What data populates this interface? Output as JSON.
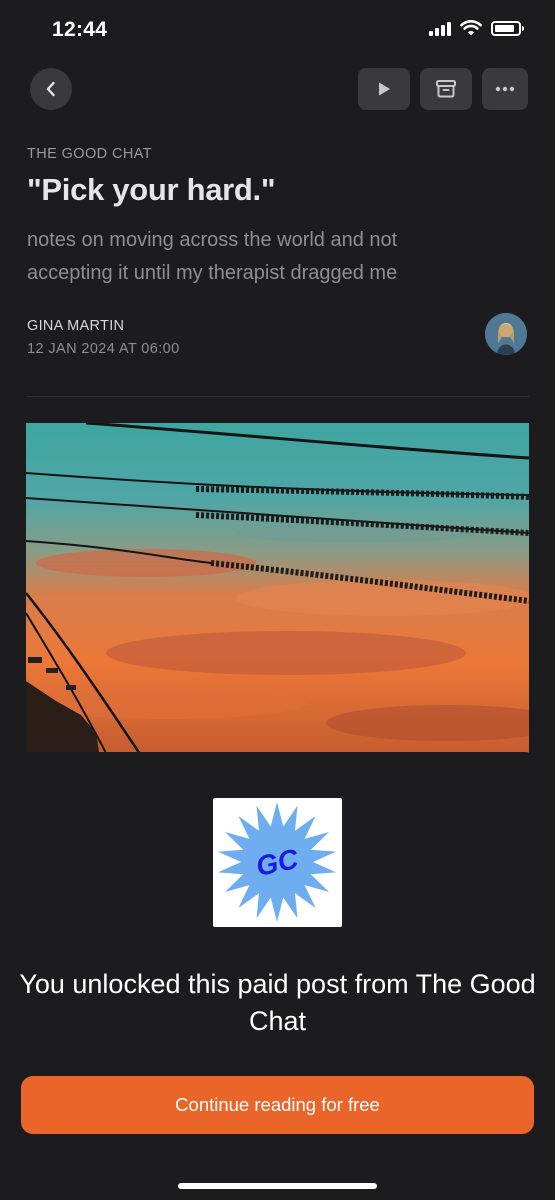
{
  "status_bar": {
    "time": "12:44",
    "signal_icon": "cellular-signal-icon",
    "wifi_icon": "wifi-icon",
    "battery_icon": "battery-icon",
    "battery_level": 0.85
  },
  "nav": {
    "back_icon": "chevron-left-icon",
    "play_icon": "play-icon",
    "archive_icon": "archive-icon",
    "more_icon": "ellipsis-icon"
  },
  "article": {
    "publication": "THE GOOD CHAT",
    "title": "\"Pick your hard.\"",
    "subtitle": "notes on moving across the world and not accepting it until my therapist dragged me",
    "author": "GINA MARTIN",
    "date": "12 JAN 2024 AT 06:00"
  },
  "paywall": {
    "logo_text": "GC",
    "message": "You unlocked this paid post from The Good Chat",
    "cta_label": "Continue reading for free"
  },
  "colors": {
    "background": "#1c1c1e",
    "accent": "#e9652a",
    "logo_star": "#6eaef0",
    "logo_text": "#1a1ae6"
  }
}
